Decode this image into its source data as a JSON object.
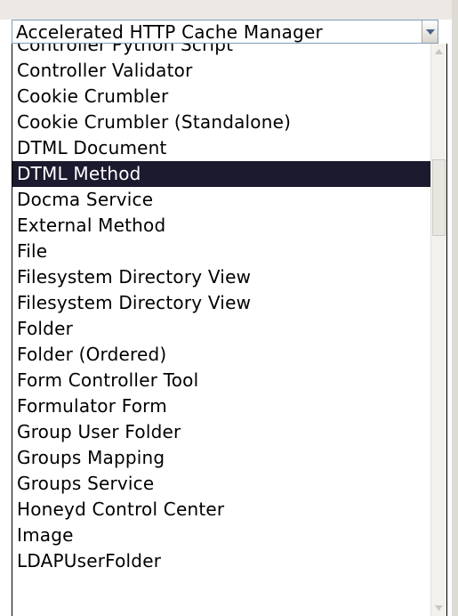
{
  "select": {
    "selected_value": "Accelerated HTTP Cache Manager",
    "arrow_icon": "triangle-down"
  },
  "options": [
    "Controller Python Script",
    "Controller Validator",
    "Cookie Crumbler",
    "Cookie Crumbler (Standalone)",
    "DTML Document",
    "DTML Method",
    "Docma Service",
    "External Method",
    "File",
    "Filesystem Directory View",
    "Filesystem Directory View",
    "Folder",
    "Folder (Ordered)",
    "Form Controller Tool",
    "Formulator Form",
    "Group User Folder",
    "Groups Mapping",
    "Groups Service",
    "Honeyd Control Center",
    "Image",
    "LDAPUserFolder"
  ],
  "highlighted_option": "DTML Method",
  "colors": {
    "highlight_bg": "#1b1a2e",
    "highlight_text": "#ffffff",
    "select_border": "#7f9db9"
  }
}
